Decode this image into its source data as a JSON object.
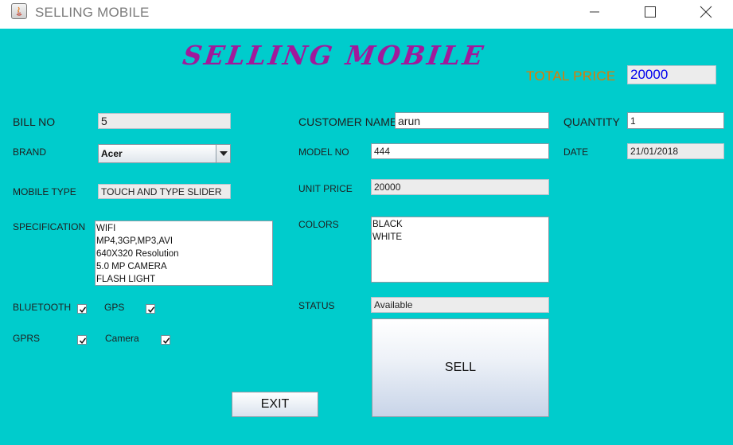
{
  "window": {
    "title": "SELLING MOBILE",
    "minimize_icon": "minimize-icon",
    "maximize_icon": "maximize-icon",
    "close_icon": "close-icon"
  },
  "header": {
    "headline": "SELLING MOBILE",
    "total_price_label": "TOTAL PRICE",
    "total_price_value": "20000"
  },
  "form": {
    "bill_no": {
      "label": "BILL NO",
      "value": "5"
    },
    "brand": {
      "label": "BRAND",
      "value": "Acer"
    },
    "mobile_type": {
      "label": "MOBILE TYPE",
      "value": "TOUCH AND TYPE SLIDER"
    },
    "specification": {
      "label": "SPECIFICATION",
      "items": [
        "WIFI",
        "MP4,3GP,MP3,AVI",
        "640X320 Resolution",
        "5.0 MP CAMERA",
        "FLASH LIGHT"
      ]
    },
    "features": {
      "bluetooth": {
        "label": "BLUETOOTH",
        "checked": true
      },
      "gps": {
        "label": "GPS",
        "checked": true
      },
      "gprs": {
        "label": "GPRS",
        "checked": true
      },
      "camera": {
        "label": "Camera",
        "checked": true
      }
    },
    "customer_name": {
      "label": "CUSTOMER NAME",
      "value": "arun"
    },
    "model_no": {
      "label": "MODEL NO",
      "value": "444"
    },
    "unit_price": {
      "label": "UNIT PRICE",
      "value": "20000"
    },
    "colors": {
      "label": "COLORS",
      "items": [
        "BLACK",
        "WHITE"
      ]
    },
    "status": {
      "label": "STATUS",
      "value": "Available"
    },
    "quantity": {
      "label": "QUANTITY",
      "value": "1"
    },
    "date": {
      "label": "DATE",
      "value": "21/01/2018"
    }
  },
  "buttons": {
    "sell_label": "SELL",
    "exit_label": "EXIT"
  },
  "colors": {
    "background": "#00cccc",
    "headline": "#a01a9b",
    "total_label": "#e07a00",
    "total_value": "#0000ee"
  }
}
